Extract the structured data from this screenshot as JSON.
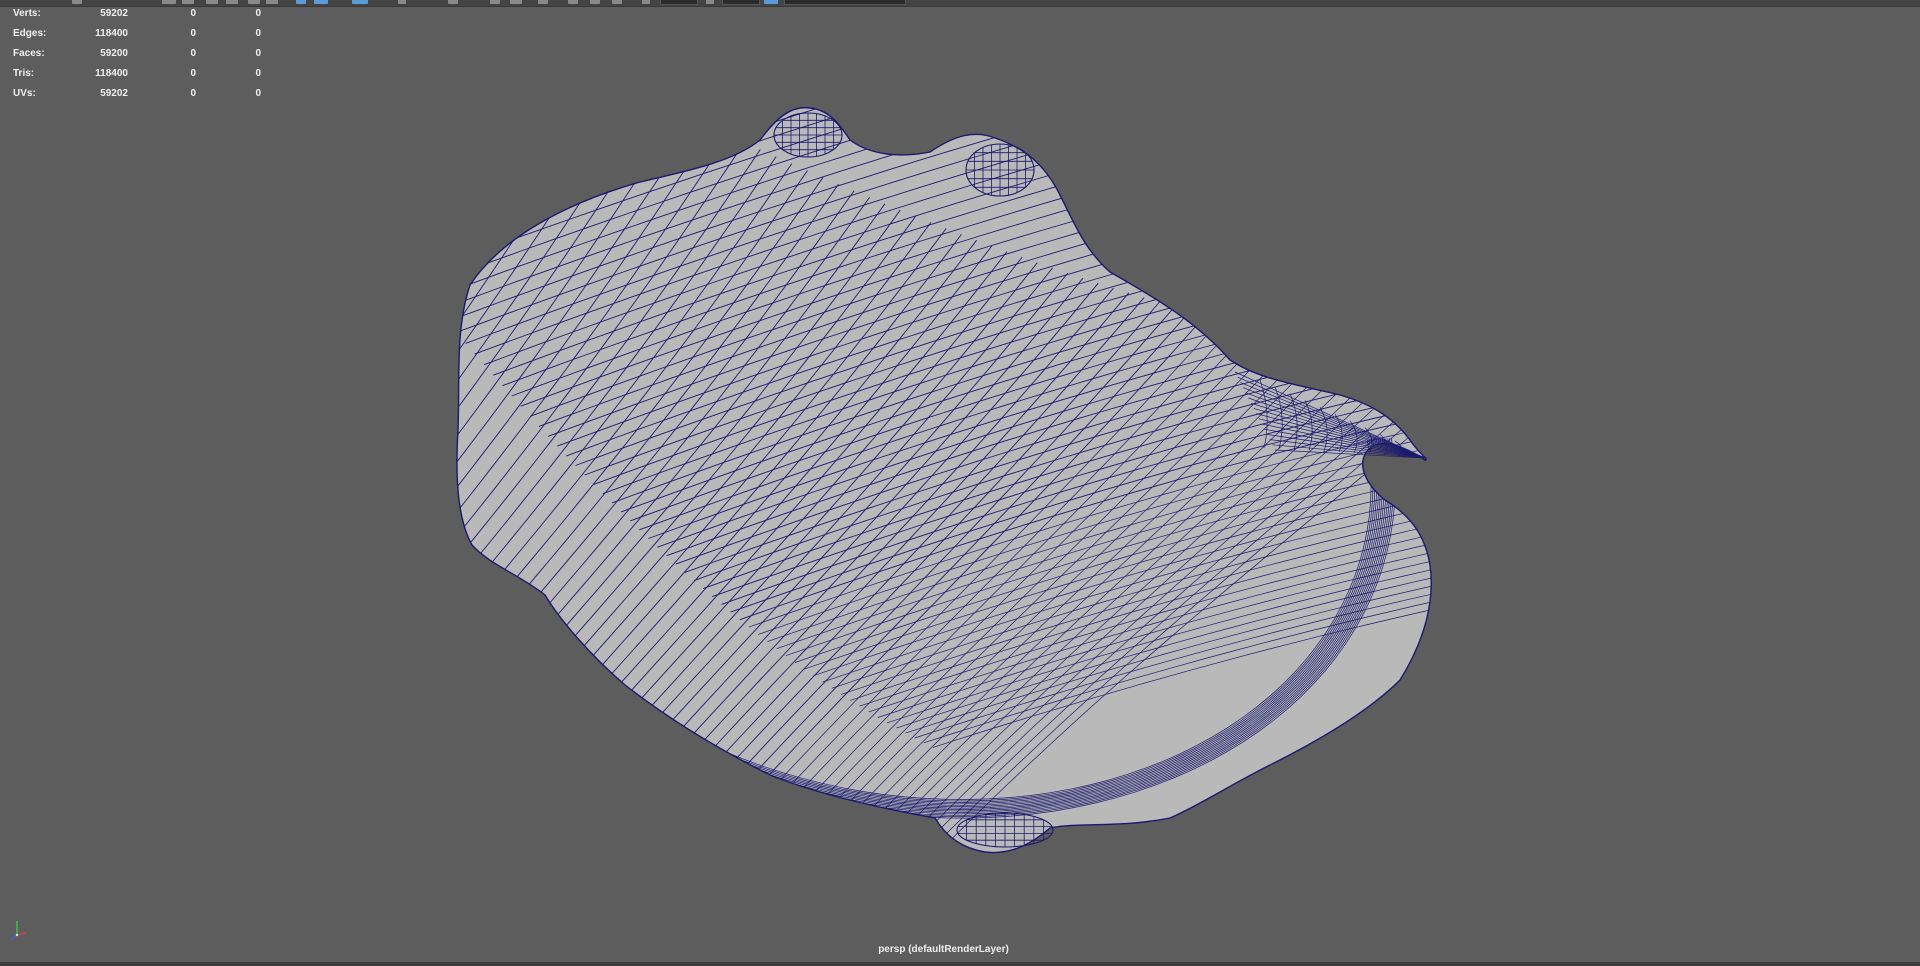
{
  "hud": {
    "rows": [
      {
        "label": "Verts:",
        "values": [
          "59202",
          "0",
          "0"
        ]
      },
      {
        "label": "Edges:",
        "values": [
          "118400",
          "0",
          "0"
        ]
      },
      {
        "label": "Faces:",
        "values": [
          "59200",
          "0",
          "0"
        ]
      },
      {
        "label": "Tris:",
        "values": [
          "118400",
          "0",
          "0"
        ]
      },
      {
        "label": "UVs:",
        "values": [
          "59202",
          "0",
          "0"
        ]
      }
    ]
  },
  "viewport": {
    "camera_label": "persp (defaultRenderLayer)",
    "background_color": "#5d5d5d",
    "mesh_fill_color": "#b9b9b9",
    "wire_color": "#1a1a6e"
  },
  "toolbar": {
    "icons": [
      "shelf-icon",
      "select-icon",
      "lasso-icon",
      "paint-icon",
      "move-icon",
      "rotate-icon",
      "scale-icon",
      "snap-grid-icon",
      "snap-curve-icon",
      "snap-point-icon",
      "history-icon",
      "render-icon",
      "ipr-icon",
      "render-settings-icon",
      "camera-icon",
      "search-icon"
    ]
  },
  "axis_gizmo": {
    "icon": "axis-gizmo-icon",
    "x_color": "#e04040",
    "y_color": "#40c040",
    "z_color": "#4060e0"
  }
}
